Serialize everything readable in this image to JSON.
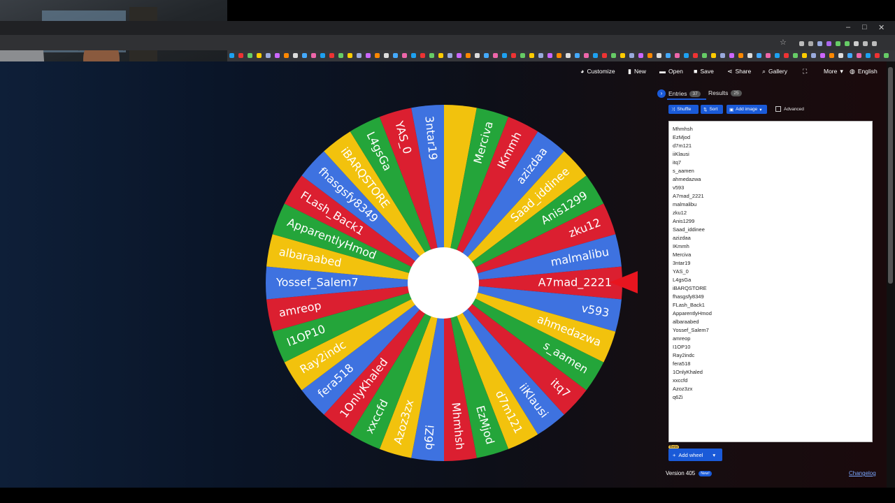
{
  "browser": {
    "window_controls": [
      "–",
      "□",
      "✕"
    ]
  },
  "toolbar": {
    "customize": "Customize",
    "new": "New",
    "open": "Open",
    "save": "Save",
    "share": "Share",
    "gallery": "Gallery",
    "more": "More",
    "language": "English"
  },
  "tabs": {
    "entries_label": "Entries",
    "entries_count": "37",
    "results_label": "Results",
    "results_count": "25"
  },
  "entry_tools": {
    "shuffle": "Shuffle",
    "sort": "Sort",
    "add_image": "Add image",
    "advanced": "Advanced"
  },
  "entries": [
    "Mhmhsh",
    "EzMjod",
    "d7m121",
    "iiKlausi",
    "itq7",
    "s_aamen",
    "ahmedazwa",
    "v593",
    "A7mad_2221",
    "malmalibu",
    "zku12",
    "Anis1299",
    "Saad_iddinee",
    "azizdaa",
    "IKmmh",
    "Merciva",
    "3ntar19",
    "YAS_0",
    "L4gsGa",
    "iBARQSTORE",
    "fhasgsfy8349",
    "FLash_Back1",
    "ApparentlyHmod",
    "albaraabed",
    "Yossef_Salem7",
    "amreop",
    "I1OP10",
    "Ray2indc",
    "fera518",
    "1OnlyKhaled",
    "xxccfd",
    "Azoz3zx",
    "q6Zi"
  ],
  "wheel": {
    "segments": [
      "A7mad_2221",
      "v593",
      "ahmedazwa",
      "s_aamen",
      "itq7",
      "iiKlausi",
      "d7m121",
      "EzMjod",
      "Mhmhsh",
      "q6Zi",
      "Azoz3zx",
      "xxccfd",
      "1OnlyKhaled",
      "fera518",
      "Ray2indc",
      "I1OP10",
      "amreop",
      "Yossef_Salem7",
      "albaraabed",
      "ApparentlyHmod",
      "FLash_Back1",
      "fhasgsfy8349",
      "iBARQSTORE",
      "L4gsGa",
      "YAS_0",
      "3ntar19",
      "",
      "Merciva",
      "IKmmh",
      "azizdaa",
      "Saad_iddinee",
      "Anis1299",
      "zku12",
      "malmalibu"
    ],
    "colors": [
      "#db1f30",
      "#3e72e0",
      "#f2c20d",
      "#24a53a"
    ],
    "pointer_color": "#e8151f"
  },
  "footer": {
    "beta": "Beta",
    "add_wheel": "Add wheel",
    "version": "Version 405",
    "new_badge": "New!",
    "changelog": "Changelog"
  }
}
